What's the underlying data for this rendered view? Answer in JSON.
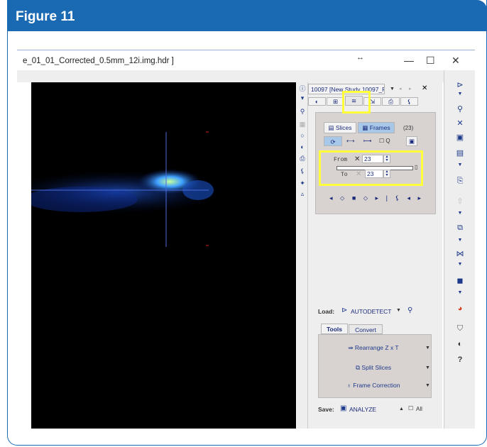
{
  "figure": {
    "title": "Figure 11"
  },
  "window": {
    "title": "e_01_01_Corrected_0.5mm_12i.img.hdr ]",
    "resize_icon": "↔",
    "minimize": "—",
    "maximize": "☐",
    "close": "✕"
  },
  "study": {
    "selector": "10097 [New Study 10097_P...",
    "close": "✕"
  },
  "tabs": {
    "count": 5
  },
  "mode": {
    "slices_label": "Slices",
    "frames_label": "Frames",
    "count": "(23)"
  },
  "range": {
    "from_label": "From",
    "from_value": "23",
    "to_label": "To",
    "to_value": "23"
  },
  "loader": {
    "label": "Load:",
    "format": "AUTODETECT"
  },
  "tool_tabs": {
    "tools": "Tools",
    "convert": "Convert"
  },
  "tools": [
    {
      "label": "Rearrange Z x T"
    },
    {
      "label": "Split Slices"
    },
    {
      "label": "Frame Correction"
    }
  ],
  "save": {
    "label": "Save:",
    "format": "ANALYZE",
    "all_label": "All"
  },
  "colors": {
    "accent": "#1a6ab3",
    "highlight": "#ffff3a"
  }
}
